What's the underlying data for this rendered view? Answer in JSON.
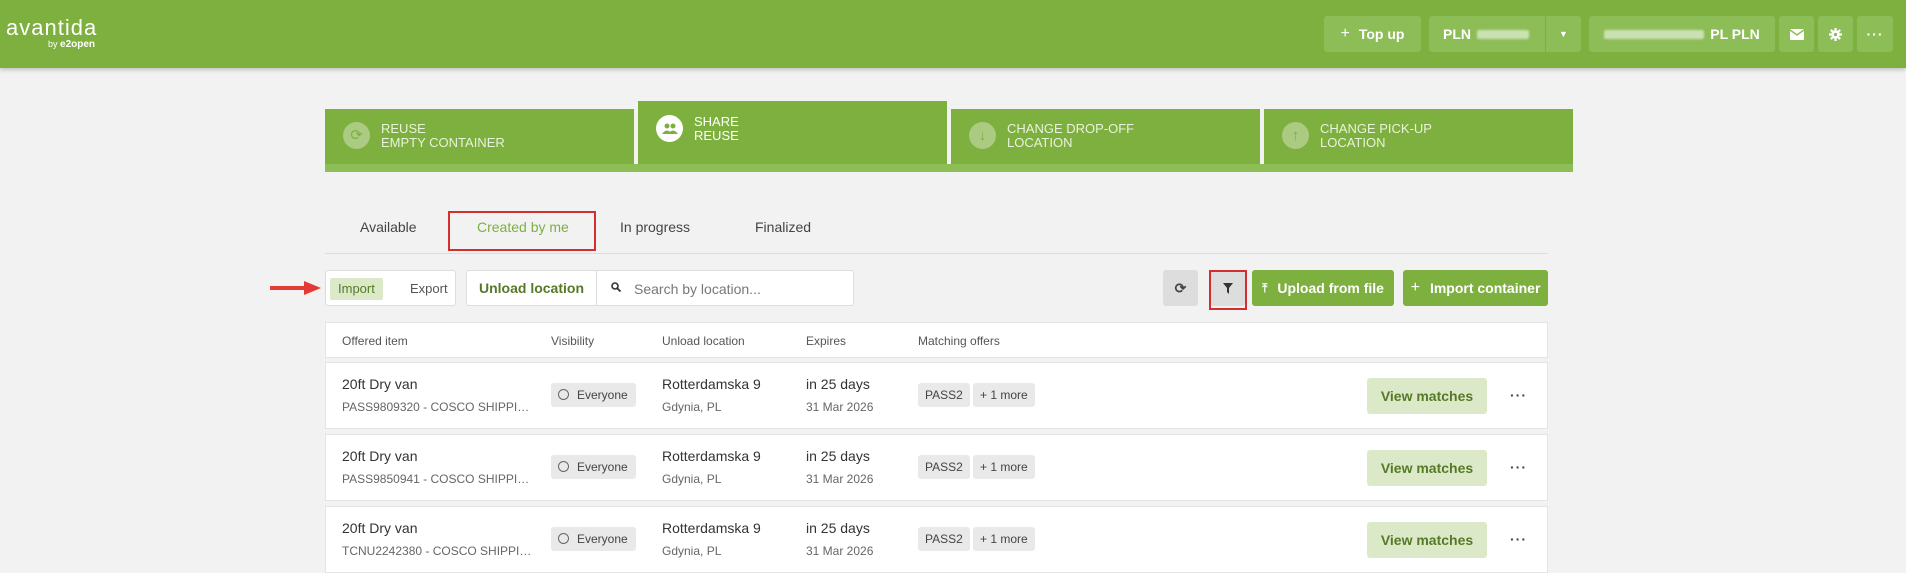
{
  "app": {
    "logo_wordmark": "avantida",
    "logo_by": "by",
    "logo_brand": "e2open"
  },
  "header": {
    "topup_label": "Top up",
    "currency_label": "PLN",
    "account_label": "PL PLN"
  },
  "modules": [
    {
      "label": "REUSE\nEMPTY CONTAINER",
      "icon": "recycle-icon"
    },
    {
      "label": "SHARE\nREUSE",
      "icon": "people-icon"
    },
    {
      "label": "CHANGE DROP-OFF\nLOCATION",
      "icon": "arrow-down-icon"
    },
    {
      "label": "CHANGE PICK-UP\nLOCATION",
      "icon": "arrow-up-icon"
    }
  ],
  "subtabs": [
    "Available",
    "Created by me",
    "In progress",
    "Finalized"
  ],
  "toolbar": {
    "import_label": "Import",
    "export_label": "Export",
    "location_label": "Unload location",
    "search_placeholder": "Search by location...",
    "upload_label": "Upload from file",
    "import_container_label": "Import container"
  },
  "table": {
    "columns": [
      "Offered item",
      "Visibility",
      "Unload location",
      "Expires",
      "Matching offers"
    ],
    "rows": [
      {
        "item": "20ft Dry van",
        "ref": "PASS9809320 - COSCO SHIPPING...",
        "visibility": "Everyone",
        "location": "Rotterdamska 9",
        "country": "Gdynia, PL",
        "expires": "in 25 days",
        "date": "31 Mar 2026",
        "offer": "PASS2",
        "more": "+ 1 more",
        "action": "View matches"
      },
      {
        "item": "20ft Dry van",
        "ref": "PASS9850941 - COSCO SHIPPING...",
        "visibility": "Everyone",
        "location": "Rotterdamska 9",
        "country": "Gdynia, PL",
        "expires": "in 25 days",
        "date": "31 Mar 2026",
        "offer": "PASS2",
        "more": "+ 1 more",
        "action": "View matches"
      },
      {
        "item": "20ft Dry van",
        "ref": "TCNU2242380 - COSCO SHIPPING...",
        "visibility": "Everyone",
        "location": "Rotterdamska 9",
        "country": "Gdynia, PL",
        "expires": "in 25 days",
        "date": "31 Mar 2026",
        "offer": "PASS2",
        "more": "+ 1 more",
        "action": "View matches"
      }
    ]
  },
  "colors": {
    "brand": "#7db03e",
    "highlight": "#d32f2f"
  }
}
